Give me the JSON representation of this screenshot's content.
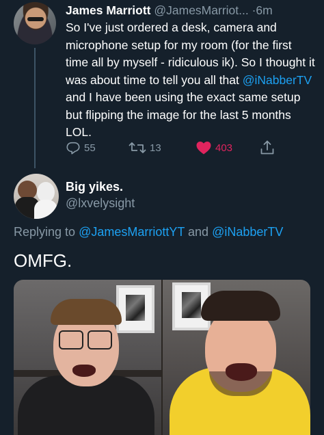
{
  "tweet1": {
    "name": "James Marriott",
    "handle": "@JamesMarriot...",
    "separator": "·",
    "time": "6m",
    "text_part1": "So I've just ordered a desk, camera and microphone setup for my room (for the first time all by myself - ridiculous ik). So I thought it was about time to tell you all that ",
    "mention": "@iNabberTV",
    "text_part2": " and I have been using the exact same setup but flipping the image for the last 5 months LOL.",
    "replies": "55",
    "retweets": "13",
    "likes": "403"
  },
  "tweet2": {
    "name": "Big yikes.",
    "handle": "@lxvelysight",
    "replying_prefix": "Replying to ",
    "replying_to_1": "@JamesMarriottYT",
    "replying_and": " and ",
    "replying_to_2": "@iNabberTV",
    "text": "OMFG."
  },
  "colors": {
    "background": "#15202b",
    "text": "#ffffff",
    "muted": "#8899a6",
    "link": "#1da1f2",
    "like": "#e0245e",
    "thread_line": "#3d5466"
  },
  "icons": {
    "reply": "reply-bubble-icon",
    "retweet": "retweet-arrows-icon",
    "like": "heart-filled-icon",
    "share": "share-upload-icon"
  }
}
